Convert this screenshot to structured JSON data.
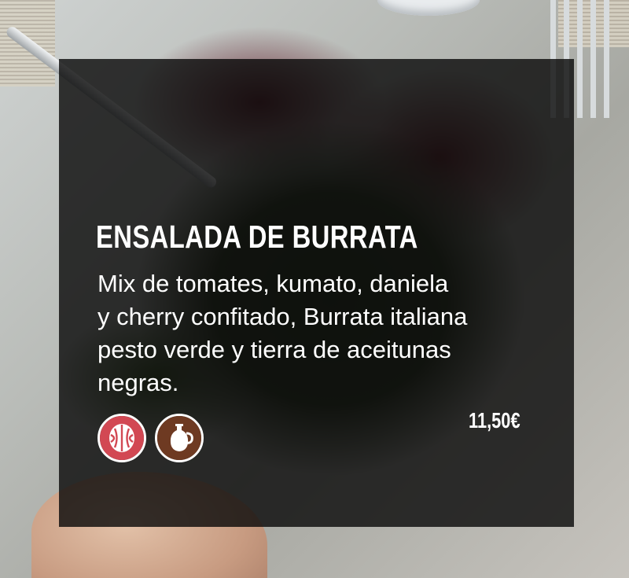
{
  "menu_item": {
    "title": "ENSALADA DE BURRATA",
    "description_lines": [
      "Mix de tomates, kumato, daniela",
      "y cherry confitado, Burrata italiana",
      "pesto verde y tierra de aceitunas",
      "negras."
    ],
    "price": "11,50€"
  },
  "allergen_icons": [
    {
      "name": "nuts-icon",
      "color": "#d24853"
    },
    {
      "name": "sulphites-jug-icon",
      "color": "#6e3a22"
    }
  ],
  "colors": {
    "overlay": "#080808",
    "text": "#ffffff"
  }
}
